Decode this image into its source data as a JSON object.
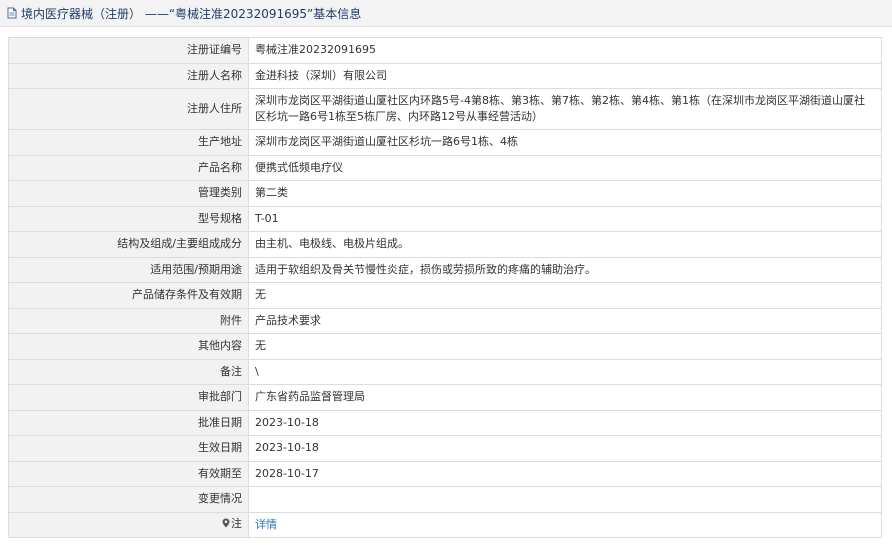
{
  "header": {
    "title": "境内医疗器械（注册） ——“粤械注准20232091695”基本信息",
    "icon": "document-icon"
  },
  "rows": [
    {
      "key": "registration-number",
      "label": "注册证编号",
      "value": "粤械注准20232091695"
    },
    {
      "key": "registrant-name",
      "label": "注册人名称",
      "value": "金进科技（深圳）有限公司"
    },
    {
      "key": "registrant-address",
      "label": "注册人住所",
      "value": "深圳市龙岗区平湖街道山厦社区内环路5号-4第8栋、第3栋、第7栋、第2栋、第4栋、第1栋（在深圳市龙岗区平湖街道山厦社区杉坑一路6号1栋至5栋厂房、内环路12号从事经营活动）"
    },
    {
      "key": "production-address",
      "label": "生产地址",
      "value": "深圳市龙岗区平湖街道山厦社区杉坑一路6号1栋、4栋"
    },
    {
      "key": "product-name",
      "label": "产品名称",
      "value": "便携式低频电疗仪"
    },
    {
      "key": "management-category",
      "label": "管理类别",
      "value": "第二类"
    },
    {
      "key": "model-spec",
      "label": "型号规格",
      "value": "T-01"
    },
    {
      "key": "structure-composition",
      "label": "结构及组成/主要组成成分",
      "value": "由主机、电极线、电极片组成。"
    },
    {
      "key": "scope-of-use",
      "label": "适用范围/预期用途",
      "value": "适用于软组织及骨关节慢性炎症，损伤或劳损所致的疼痛的辅助治疗。"
    },
    {
      "key": "storage-validity",
      "label": "产品储存条件及有效期",
      "value": "无"
    },
    {
      "key": "attachment",
      "label": "附件",
      "value": "产品技术要求"
    },
    {
      "key": "other-content",
      "label": "其他内容",
      "value": "无"
    },
    {
      "key": "remarks",
      "label": "备注",
      "value": "\\"
    },
    {
      "key": "approval-department",
      "label": "审批部门",
      "value": "广东省药品监督管理局"
    },
    {
      "key": "approval-date",
      "label": "批准日期",
      "value": "2023-10-18"
    },
    {
      "key": "effective-date",
      "label": "生效日期",
      "value": "2023-10-18"
    },
    {
      "key": "expiry-date",
      "label": "有效期至",
      "value": "2028-10-17"
    },
    {
      "key": "change-info",
      "label": "变更情况",
      "value": ""
    },
    {
      "key": "note",
      "label": "注",
      "value": "详情",
      "link": true,
      "icon": "map-pin-icon"
    }
  ],
  "colors": {
    "title_text": "#1f3d6b",
    "link": "#2b76c5",
    "label_bg": "#f2f2f2",
    "border": "#dcdcdc"
  }
}
